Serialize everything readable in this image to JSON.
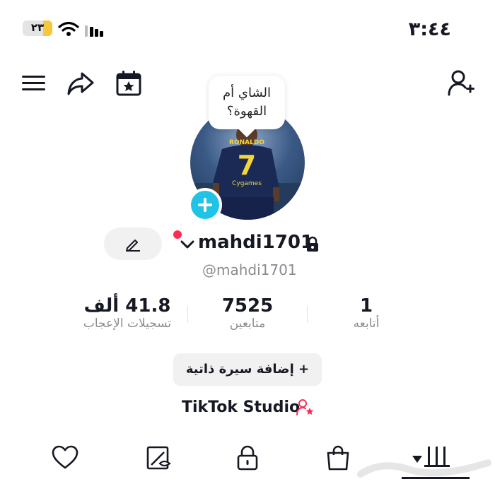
{
  "status_bar": {
    "time": "٣:٤٤",
    "battery": "٢٣"
  },
  "profile": {
    "bubble_text_line1": "الشاي أم",
    "bubble_text_line2": "القهوة؟",
    "username": "mahdi1701",
    "handle": "@mahdi1701",
    "jersey_number": "7",
    "jersey_name": "RONALDO",
    "sponsor": "Cygames"
  },
  "stats": [
    {
      "value": "41.8 ألف",
      "label": "تسجيلات الإعجاب"
    },
    {
      "value": "7525",
      "label": "متابعين"
    },
    {
      "value": "1",
      "label": "أتابعه"
    }
  ],
  "bio_button": {
    "label": "+ إضافة سيرة ذاتية"
  },
  "studio": {
    "label": "TikTok Studio"
  },
  "colors": {
    "accent": "#fe2c55",
    "plus": "#20c3e6",
    "battery": "#f6c83b"
  },
  "icons": [
    "menu-icon",
    "share-icon",
    "calendar-star-icon",
    "add-friend-icon",
    "heart-icon",
    "tagged-icon",
    "lock-icon",
    "shop-bag-icon",
    "grid-icon"
  ],
  "watermark": "حراج"
}
